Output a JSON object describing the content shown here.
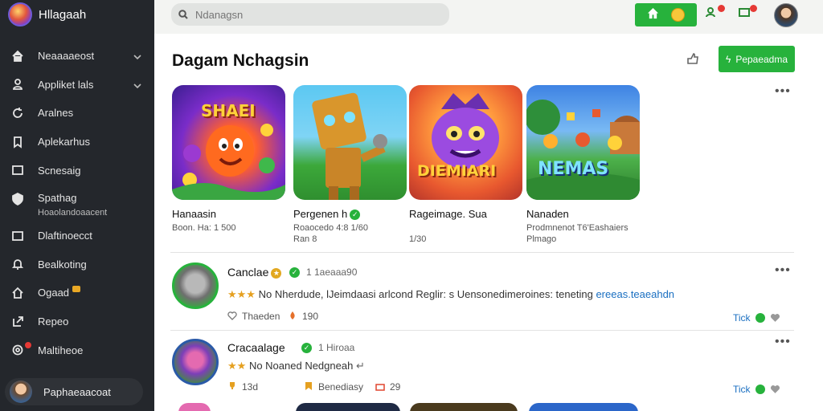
{
  "sidebar": {
    "app_name": "Hllagaah",
    "items": [
      {
        "label": "Neaaaaeost",
        "icon": "home-icon",
        "expandable": true
      },
      {
        "label": "Appliket lals",
        "icon": "user-icon",
        "expandable": true
      },
      {
        "label": "Aralnes",
        "icon": "refresh-icon"
      },
      {
        "label": "Aplekarhus",
        "icon": "bookmark-icon"
      },
      {
        "label": "Scnesaig",
        "icon": "square-icon"
      },
      {
        "label": "Spathag",
        "sublabel": "Hoaolandoaacent",
        "icon": "shield-icon"
      },
      {
        "label": "Dlaftinoecct",
        "icon": "square-icon"
      },
      {
        "label": "Bealkoting",
        "icon": "bell-icon"
      },
      {
        "label": "Ogaad",
        "icon": "home-icon",
        "badge": true
      },
      {
        "label": "Repeo",
        "icon": "export-icon"
      },
      {
        "label": "Maltiheoe",
        "icon": "gear-icon",
        "notification_dot": true
      }
    ],
    "profile_name": "Paphaeaacoat"
  },
  "topbar": {
    "search_placeholder": "Ndanagsn",
    "accent": "#27b23c"
  },
  "main": {
    "title": "Dagam Nchagsin",
    "primary_button": "Pepaeadma",
    "games": [
      {
        "name": "Hanaasin",
        "meta1": "Boon. Ha: 1 500",
        "meta2": "",
        "art_title": "SHAEI",
        "verified": false
      },
      {
        "name": "Pergenen h",
        "meta1": "Roaocedo 4:8 1/60",
        "meta2": "Ran 8",
        "art_title": "",
        "verified": true
      },
      {
        "name": "Rageimage. Sua",
        "meta1": "",
        "meta2": "1/30",
        "art_title": "DIEMIARI",
        "verified": false
      },
      {
        "name": "Nanaden",
        "meta1": "Prodmnenot T6'Eashaiers",
        "meta2": "Plmago",
        "art_title": "NEMAS",
        "verified": false
      }
    ],
    "posts": [
      {
        "author": "Canclae",
        "time": "1 1aeaaa90",
        "text": "No Nherdude, lJeimdaasi arlcond Reglir: s Uensonedimeroines: teneting",
        "link": "ereeas.teaeahdn",
        "action1": "Thaeden",
        "action2": "190",
        "likes": "Tick"
      },
      {
        "author": "Cracaalage",
        "time": "1 Hiroaa",
        "text": "No Noaned Nedgneah",
        "link": "",
        "action1": "13d",
        "action2": "Benediasy",
        "action3": "29",
        "likes": "Tick"
      }
    ]
  }
}
